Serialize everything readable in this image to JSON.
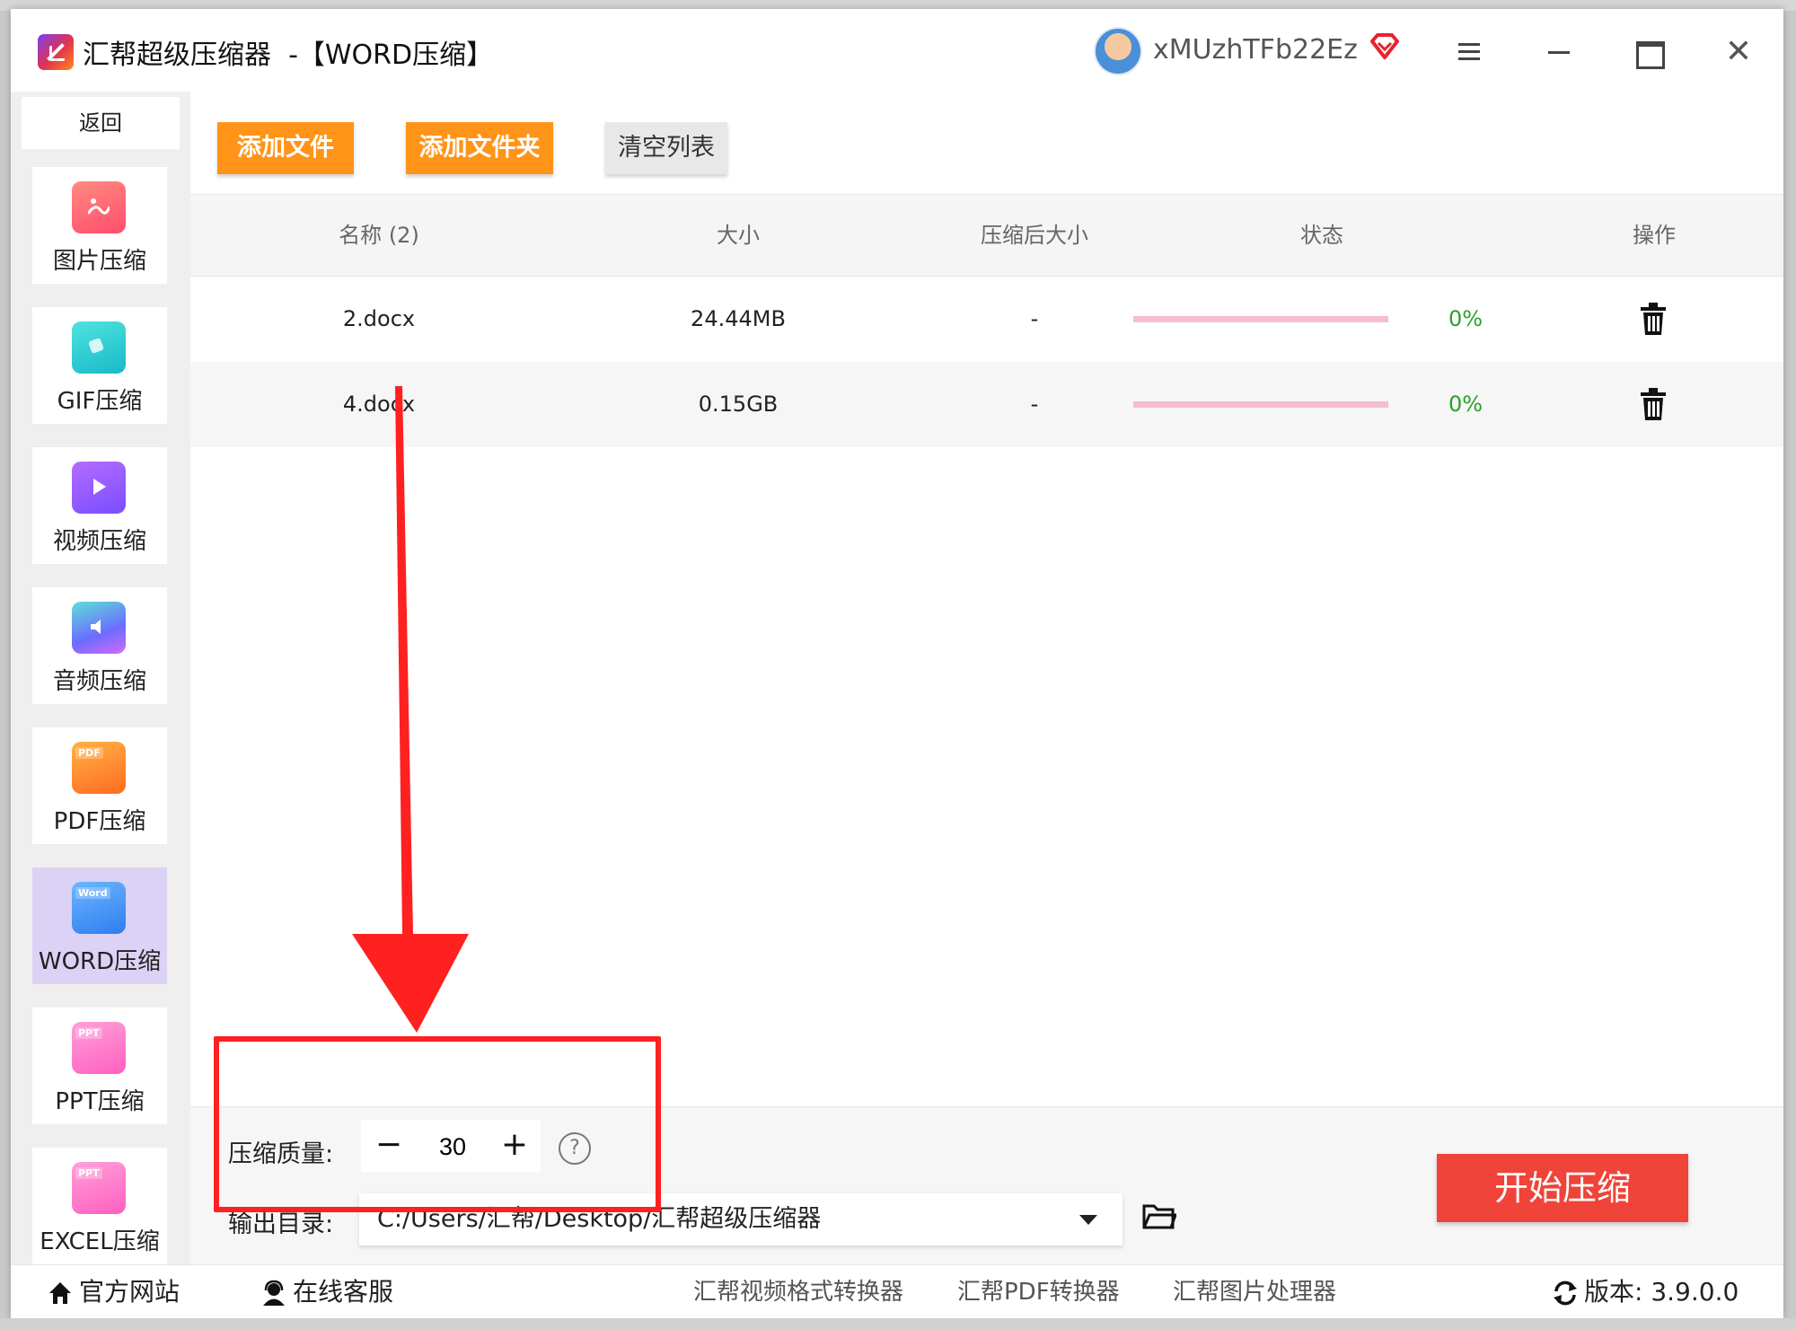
{
  "window": {
    "title": "汇帮超级压缩器  -【WORD压缩】",
    "username": "xMUzhTFb22Ez"
  },
  "sidebar": {
    "back_label": "返回",
    "items": [
      {
        "label": "图片压缩",
        "icon": "image-compress-icon"
      },
      {
        "label": "GIF压缩",
        "icon": "gif-compress-icon"
      },
      {
        "label": "视频压缩",
        "icon": "video-compress-icon"
      },
      {
        "label": "音频压缩",
        "icon": "audio-compress-icon"
      },
      {
        "label": "PDF压缩",
        "icon": "pdf-compress-icon",
        "tag": "PDF"
      },
      {
        "label": "WORD压缩",
        "icon": "word-compress-icon",
        "tag": "Word",
        "active": true
      },
      {
        "label": "PPT压缩",
        "icon": "ppt-compress-icon",
        "tag": "PPT"
      },
      {
        "label": "EXCEL压缩",
        "icon": "excel-compress-icon",
        "tag": "PPT"
      }
    ]
  },
  "toolbar": {
    "add_file": "添加文件",
    "add_folder": "添加文件夹",
    "clear_list": "清空列表"
  },
  "table": {
    "headers": [
      "名称 (2)",
      "大小",
      "压缩后大小",
      "状态",
      "操作"
    ],
    "rows": [
      {
        "name": "2.docx",
        "size": "24.44MB",
        "compressed": "-",
        "progress": "0%"
      },
      {
        "name": "4.docx",
        "size": "0.15GB",
        "compressed": "-",
        "progress": "0%"
      }
    ]
  },
  "settings": {
    "quality_label": "压缩质量:",
    "quality_value": "30",
    "minus": "−",
    "plus": "+",
    "help": "?",
    "output_label": "输出目录:",
    "output_path": "C:/Users/汇帮/Desktop/汇帮超级压缩器",
    "start_button": "开始压缩"
  },
  "footer": {
    "website": "官方网站",
    "support": "在线客服",
    "links": [
      "汇帮视频格式转换器",
      "汇帮PDF转换器",
      "汇帮图片处理器"
    ],
    "version": "版本:  3.9.0.0"
  },
  "colors": {
    "accent_orange": "#ff9418",
    "start_red": "#f04339",
    "active_item": "#dcd2f5",
    "progress_track": "#f6bcd0",
    "percent_green": "#2aa12a",
    "annotation_red": "#ff2020"
  }
}
